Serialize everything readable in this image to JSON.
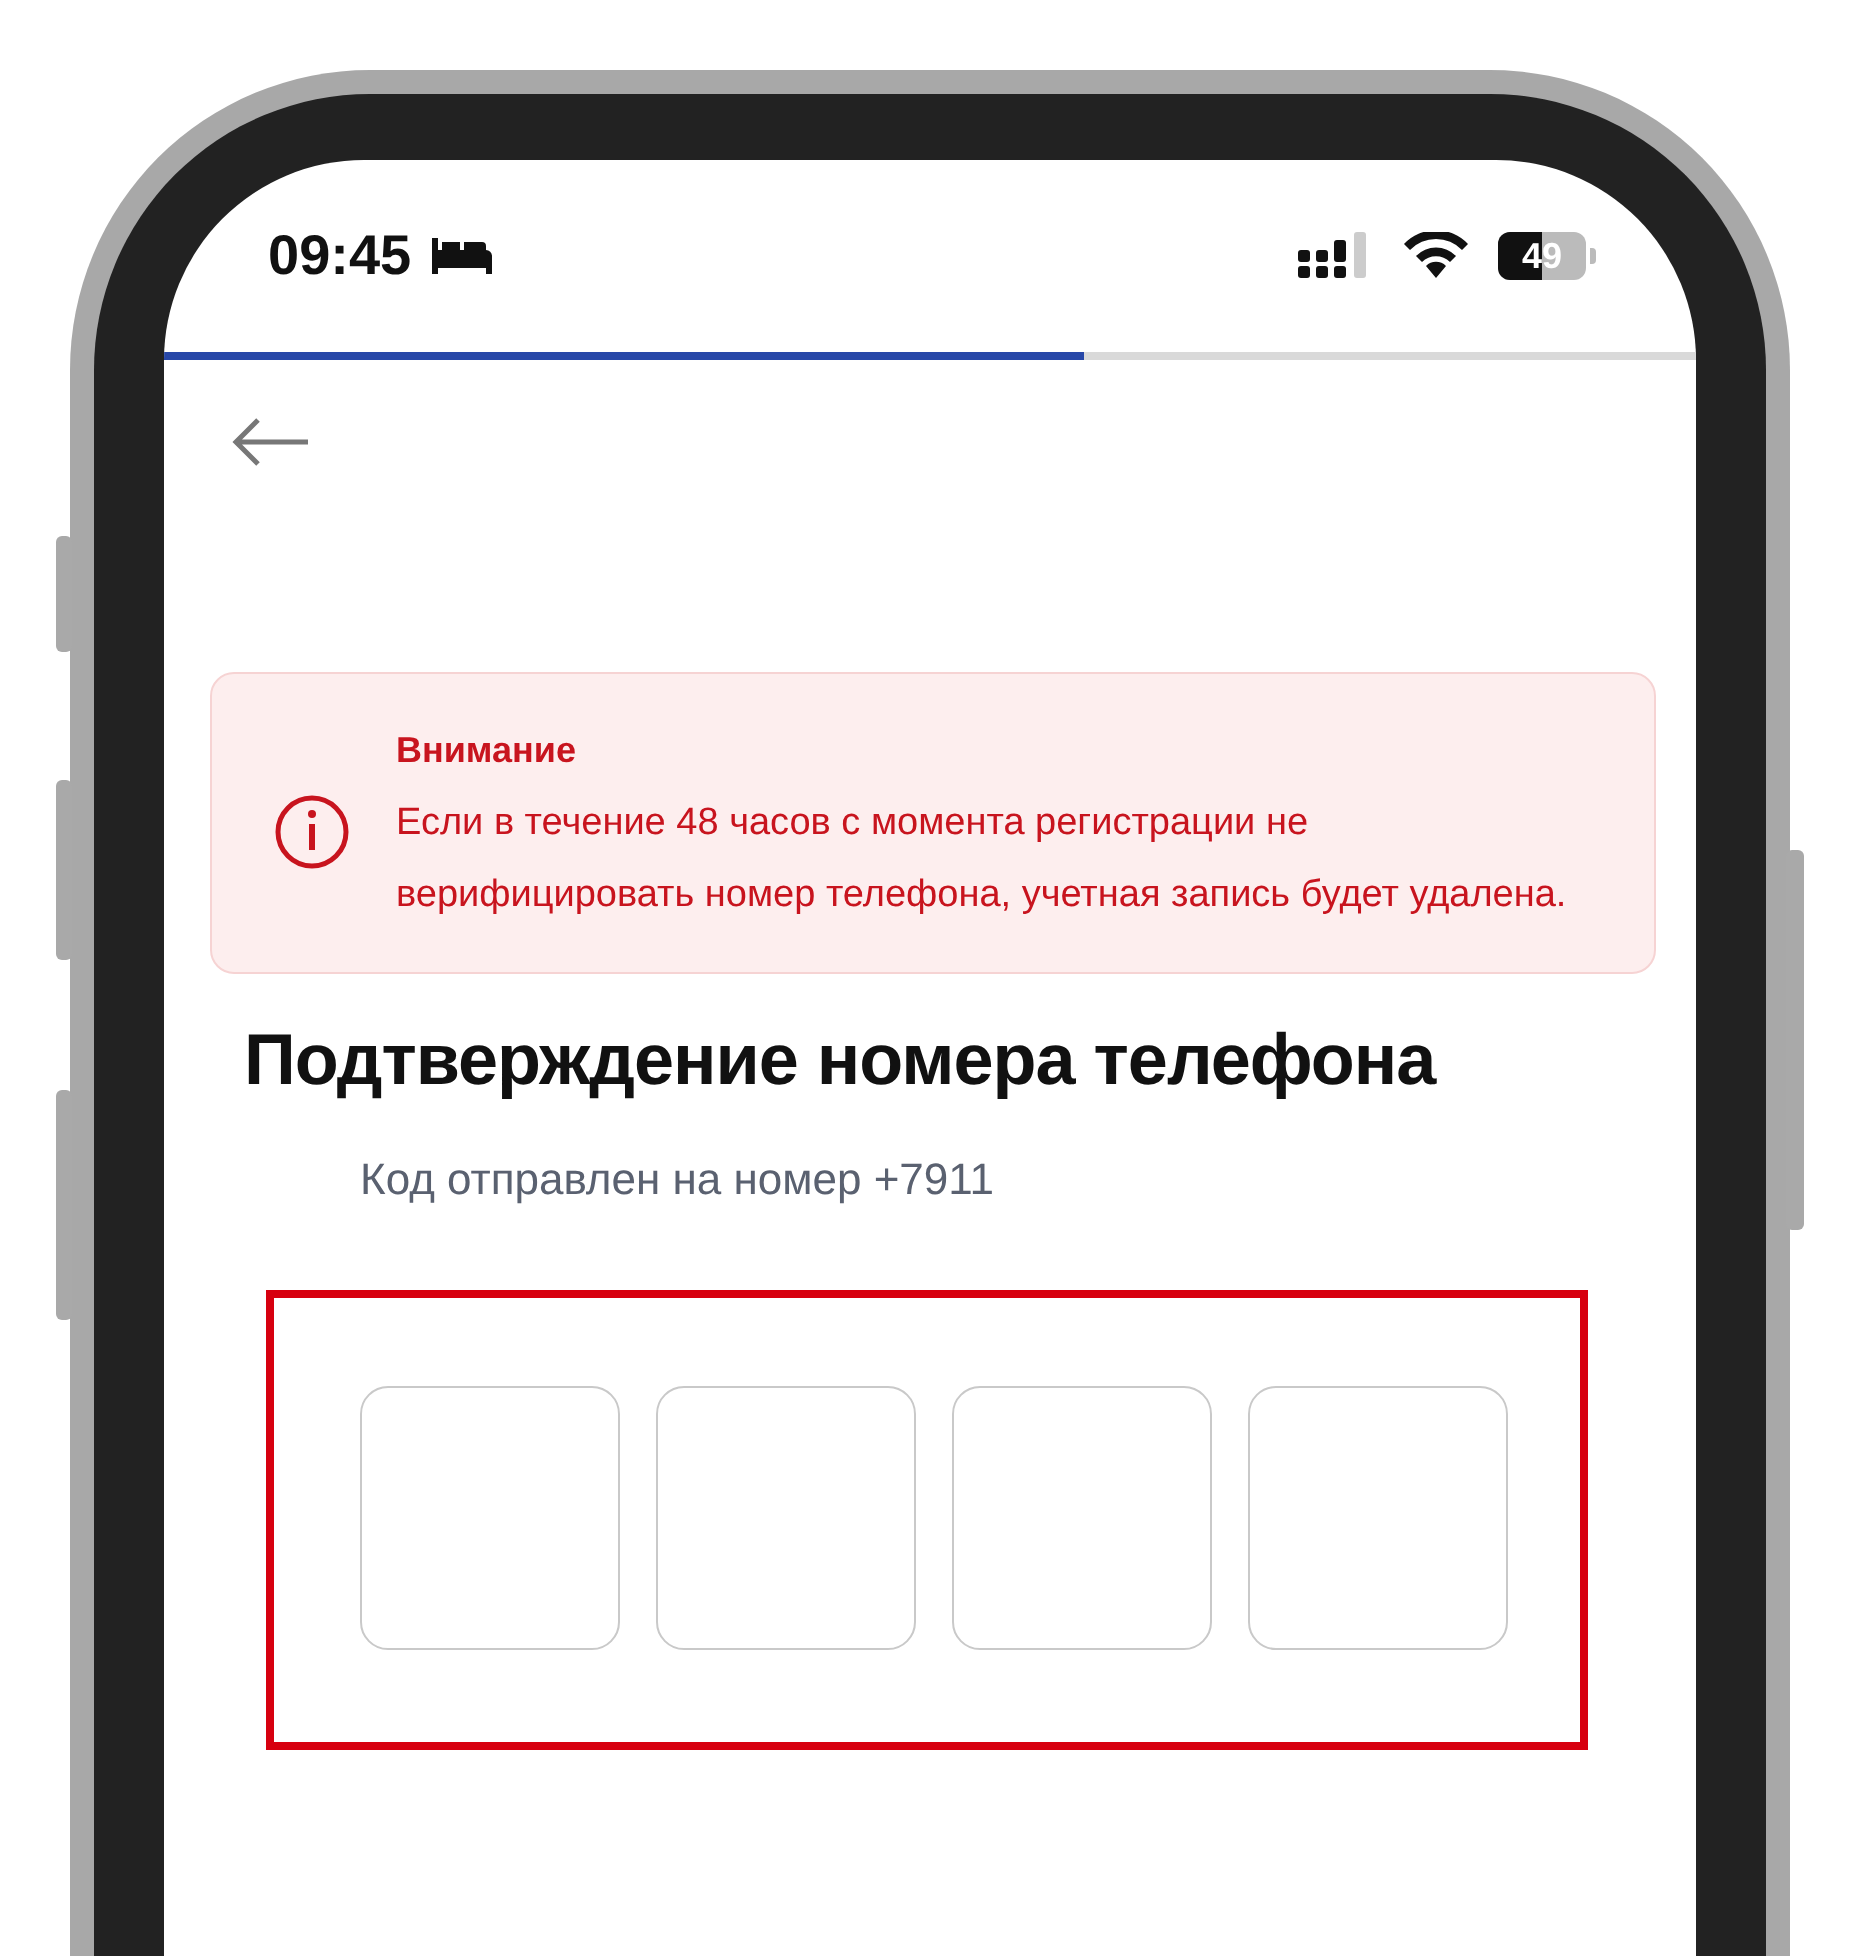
{
  "status_bar": {
    "time": "09:45",
    "battery": "49"
  },
  "progress": {
    "level": 0.6
  },
  "alert": {
    "title": "Внимание",
    "text": "Если в течение 48 часов с момента регистрации не верифицировать номер телефона, учетная запись будет удалена."
  },
  "heading": "Подтверждение номера телефона",
  "subtitle": "Код отправлен на номер +7911",
  "code_fields": [
    {
      "filled": false
    },
    {
      "filled": false
    },
    {
      "filled": false
    },
    {
      "filled": false
    }
  ]
}
